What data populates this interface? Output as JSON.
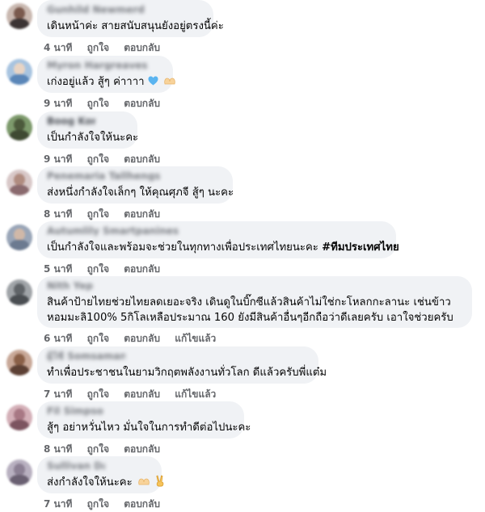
{
  "comments": [
    {
      "name": "Gunhild Newmerd",
      "text": "เดินหน้าค่ะ สายสนับสนุนยังอยู่ตรงนี้ค่ะ",
      "time": "4 นาที",
      "like": "ถูกใจ",
      "reply": "ตอบกลับ",
      "edited": ""
    },
    {
      "name": "Myron Hargreaves",
      "text": "เก่งอยู่แล้ว สู้ๆ ค่าาาา",
      "time": "9 นาที",
      "like": "ถูกใจ",
      "reply": "ตอบกลับ",
      "edited": ""
    },
    {
      "name": "Boog Kong",
      "text": "เป็นกำลังใจให้นะคะ",
      "time": "9 นาที",
      "like": "ถูกใจ",
      "reply": "ตอบกลับ",
      "edited": ""
    },
    {
      "name": "Penemaria Tallhengs",
      "text": "ส่งหนึ่งกำลังใจเล็กๆ ให้คุณศุภจี สู้ๆ นะคะ",
      "time": "8 นาที",
      "like": "ถูกใจ",
      "reply": "ตอบกลับ",
      "edited": ""
    },
    {
      "name": "Autumlily Smartpanines",
      "text": "เป็นกำลังใจและพร้อมจะช่วยในทุกทางเพื่อประเทศไทยนะคะ",
      "hashtag": "#ทีมประเทศไทย",
      "time": "5 นาที",
      "like": "ถูกใจ",
      "reply": "ตอบกลับ",
      "edited": ""
    },
    {
      "name": "Nith Yep",
      "text": "สินค้าป้ายไทยช่วยไทยลดเยอะจริง เดินดูในบิ๊กซีแล้วสินค้าไม่ใช่กะโหลกกะลานะ เช่นข้าวหอมมะลิ100% 5กิโลเหลือประมาณ 160 ยังมีสินค้าอื่นๆอีกถือว่าดีเลยครับ เอาใจช่วยครับ",
      "time": "6 นาที",
      "like": "ถูกใจ",
      "reply": "ตอบกลับ",
      "edited": "แก้ไขแล้ว"
    },
    {
      "name": "ผู้ใช้ Somsamana",
      "text": "ทำเพื่อประชาชนในยามวิกฤตพลังงานทั่วโลก ดีแล้วครับพี่แต๋ม",
      "time": "7 นาที",
      "like": "ถูกใจ",
      "reply": "ตอบกลับ",
      "edited": "แก้ไขแล้ว"
    },
    {
      "name": "Fil Simpson",
      "text": "สู้ๆ อย่าหวั่นไหว มั่นใจในการทำดีต่อไปนะคะ",
      "time": "8 นาที",
      "like": "ถูกใจ",
      "reply": "ตอบกลับ",
      "edited": ""
    },
    {
      "name": "Sullivan Day",
      "text": "ส่งกำลังใจให้นะคะ",
      "time": "7 นาที",
      "like": "ถูกใจ",
      "reply": "ตอบกลับ",
      "edited": ""
    }
  ],
  "colors": {
    "bubble": "#f0f2f5",
    "meta": "#65676b",
    "heart": "#1da1f2"
  },
  "icons": [
    "heart-emoji-icon",
    "heart-hands-emoji-icon",
    "victory-hand-emoji-icon"
  ]
}
